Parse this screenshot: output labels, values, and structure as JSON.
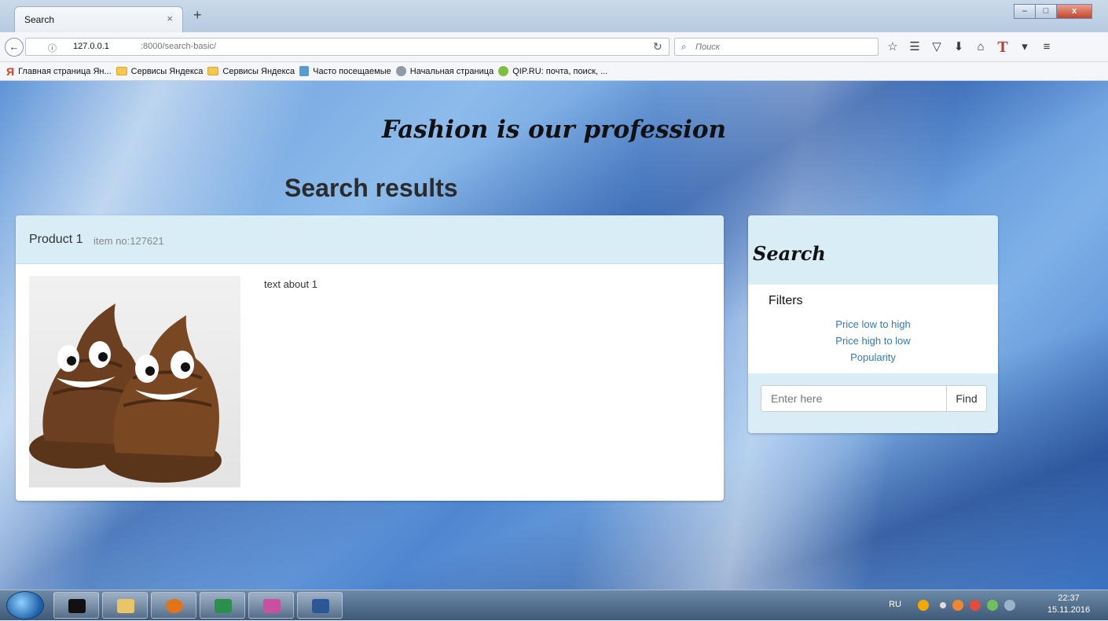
{
  "browser": {
    "tab_title": "Search",
    "tab_close": "×",
    "new_tab": "+",
    "url_host": "127.0.0.1",
    "url_rest": ":8000/search-basic/",
    "search_placeholder": "Поиск",
    "window_controls": {
      "minimize": "–",
      "maximize": "□",
      "close": "x"
    }
  },
  "bookmarks": [
    {
      "label": "Главная страница Ян...",
      "icon": "yandex-icon"
    },
    {
      "label": "Сервисы Яндекса",
      "icon": "folder-icon"
    },
    {
      "label": "Сервисы Яндекса",
      "icon": "folder-icon"
    },
    {
      "label": "Часто посещаемые",
      "icon": "page-icon"
    },
    {
      "label": "Начальная страница",
      "icon": "globe-icon"
    },
    {
      "label": "QIP.RU: почта, поиск, ...",
      "icon": "qip-icon"
    }
  ],
  "page": {
    "brand": "Fashion is our profession",
    "heading": "Search results",
    "product": {
      "name": "Product 1",
      "item_no": "item no:127621",
      "text": "text about 1"
    },
    "search_panel": {
      "title": "Search",
      "filters_title": "Filters",
      "filters": [
        "Price low to high",
        "Price high to low",
        "Popularity"
      ],
      "input_placeholder": "Enter here",
      "find_label": "Find"
    }
  },
  "taskbar": {
    "lang": "RU",
    "time": "22:37",
    "date": "15.11.2016"
  },
  "colors": {
    "panel_header": "#d9edf7",
    "link": "#337ab7",
    "accent_close": "#c3452d"
  }
}
